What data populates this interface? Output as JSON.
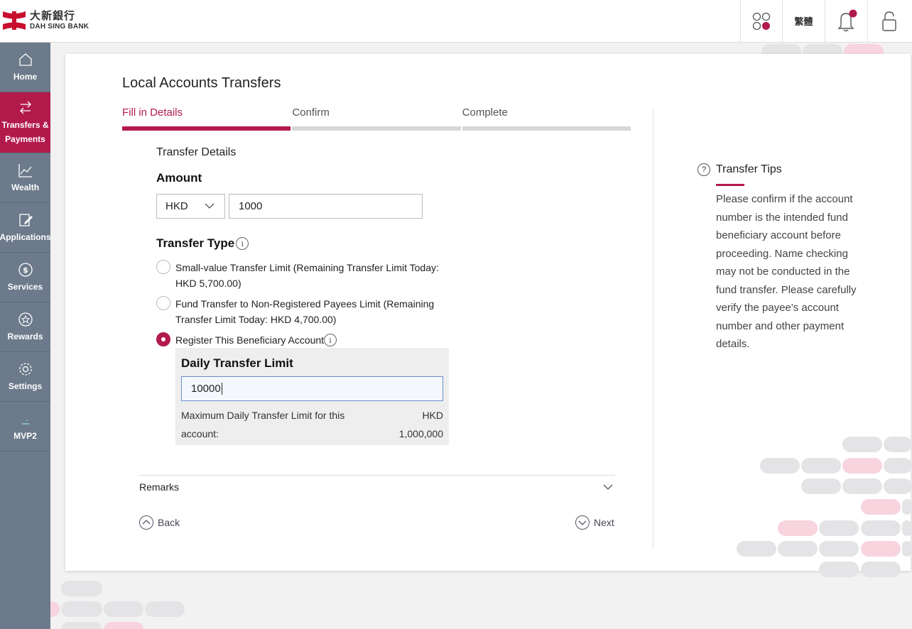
{
  "brand": {
    "name_cn": "大新銀行",
    "name_en": "DAH SING BANK",
    "color": "#b31a4c"
  },
  "header": {
    "lang_label": "繁體",
    "apps_icon": "apps-grid-icon",
    "bell_icon": "bell-icon",
    "lock_icon": "lock-icon",
    "has_notification": true
  },
  "sidebar": {
    "items": [
      {
        "label": "Home",
        "icon": "home-icon",
        "active": false
      },
      {
        "label": "Transfers & Payments",
        "icon": "transfer-icon",
        "active": true
      },
      {
        "label": "Wealth",
        "icon": "chart-icon",
        "active": false
      },
      {
        "label": "Applications",
        "icon": "edit-icon",
        "active": false
      },
      {
        "label": "Services",
        "icon": "dollar-icon",
        "active": false
      },
      {
        "label": "Rewards",
        "icon": "star-icon",
        "active": false
      },
      {
        "label": "Settings",
        "icon": "gear-icon",
        "active": false
      },
      {
        "label": "MVP2",
        "icon": "mvp-icon",
        "active": false
      }
    ]
  },
  "main": {
    "title": "Local Accounts Transfers",
    "steps": [
      {
        "label": "Fill in Details",
        "active": true
      },
      {
        "label": "Confirm",
        "active": false
      },
      {
        "label": "Complete",
        "active": false
      }
    ],
    "section_title": "Transfer Details",
    "amount": {
      "label": "Amount",
      "currency": "HKD",
      "value": "1000"
    },
    "transfer_type": {
      "label": "Transfer Type",
      "options": [
        {
          "label": "Small-value Transfer Limit (Remaining Transfer Limit Today: HKD 5,700.00)",
          "selected": false
        },
        {
          "label": "Fund Transfer to Non-Registered Payees Limit (Remaining Transfer Limit Today: HKD 4,700.00)",
          "selected": false
        },
        {
          "label": "Register This Beneficiary Account",
          "selected": true
        }
      ]
    },
    "daily_limit": {
      "title": "Daily Transfer Limit",
      "value": "10000",
      "max_label": "Maximum Daily Transfer Limit for this account:",
      "max_currency": "HKD",
      "max_value": "1,000,000"
    },
    "remarks_label": "Remarks",
    "back_label": "Back",
    "next_label": "Next"
  },
  "tips": {
    "title": "Transfer Tips",
    "text": "Please confirm if the account number is the intended fund beneficiary account before proceeding. Name checking may not be conducted in the fund transfer. Please carefully verify the payee's account number and other payment details."
  }
}
